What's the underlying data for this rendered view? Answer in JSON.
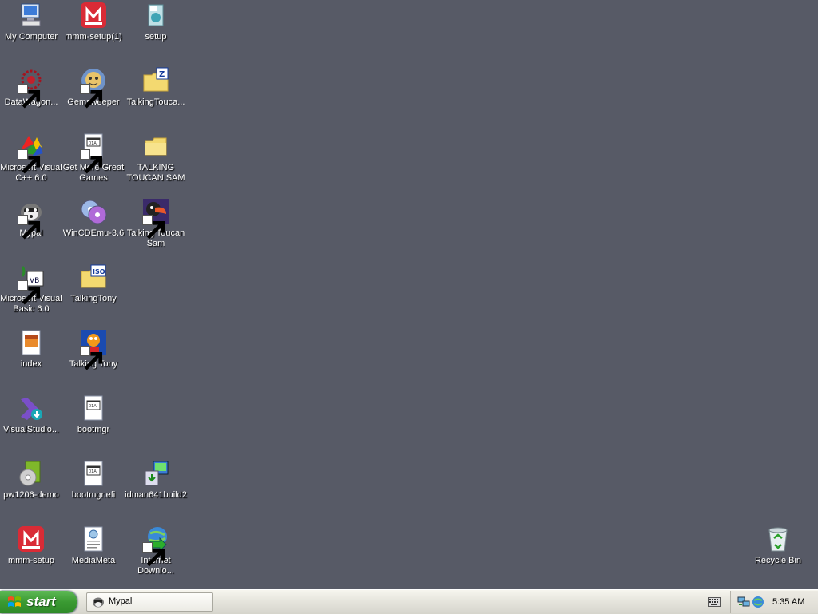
{
  "desktop": {
    "icons": [
      {
        "name": "My Computer",
        "icon": "computer-icon"
      },
      {
        "name": "mmm-setup(1)",
        "icon": "installer-icon"
      },
      {
        "name": "setup",
        "icon": "setup-icon"
      },
      {
        "name": "DataWagon...",
        "icon": "datawagon-icon"
      },
      {
        "name": "Gemsweeper",
        "icon": "gemsweeper-icon"
      },
      {
        "name": "TalkingTouca...",
        "icon": "zip-folder-icon"
      },
      {
        "name": "Microsoft Visual C++ 6.0",
        "icon": "visual-cpp-icon"
      },
      {
        "name": "Get More Great Games",
        "icon": "web-document-icon"
      },
      {
        "name": "TALKING TOUCAN SAM",
        "icon": "folder-icon"
      },
      {
        "name": "Mypal",
        "icon": "mypal-icon"
      },
      {
        "name": "WinCDEmu-3.6",
        "icon": "cd-icon"
      },
      {
        "name": "Talking Toucan Sam",
        "icon": "toucan-icon"
      },
      {
        "name": "Microsoft Visual Basic 6.0",
        "icon": "visual-basic-icon"
      },
      {
        "name": "TalkingTony",
        "icon": "iso-folder-icon"
      },
      {
        "name": "index",
        "icon": "html-file-icon"
      },
      {
        "name": "Talking Tony",
        "icon": "tony-icon"
      },
      {
        "name": "VisualStudio...",
        "icon": "visual-studio-icon"
      },
      {
        "name": "bootmgr",
        "icon": "system-file-icon"
      },
      {
        "name": "pw1206-demo",
        "icon": "disc-box-icon"
      },
      {
        "name": "bootmgr.efi",
        "icon": "system-file-icon"
      },
      {
        "name": "idman641build2",
        "icon": "idm-installer-icon"
      },
      {
        "name": "mmm-setup",
        "icon": "installer-icon"
      },
      {
        "name": "MediaMeta",
        "icon": "media-file-icon"
      },
      {
        "name": "Internet Downlo...",
        "icon": "idm-globe-icon"
      },
      {
        "name": "Recycle Bin",
        "icon": "recycle-bin-icon"
      }
    ]
  },
  "taskbar": {
    "start_label": "start",
    "tasks": [
      {
        "label": "Mypal",
        "icon": "mypal-icon"
      }
    ],
    "tray_icons": [
      "network-icon",
      "globe-icon"
    ],
    "clock": "5:35 AM"
  }
}
